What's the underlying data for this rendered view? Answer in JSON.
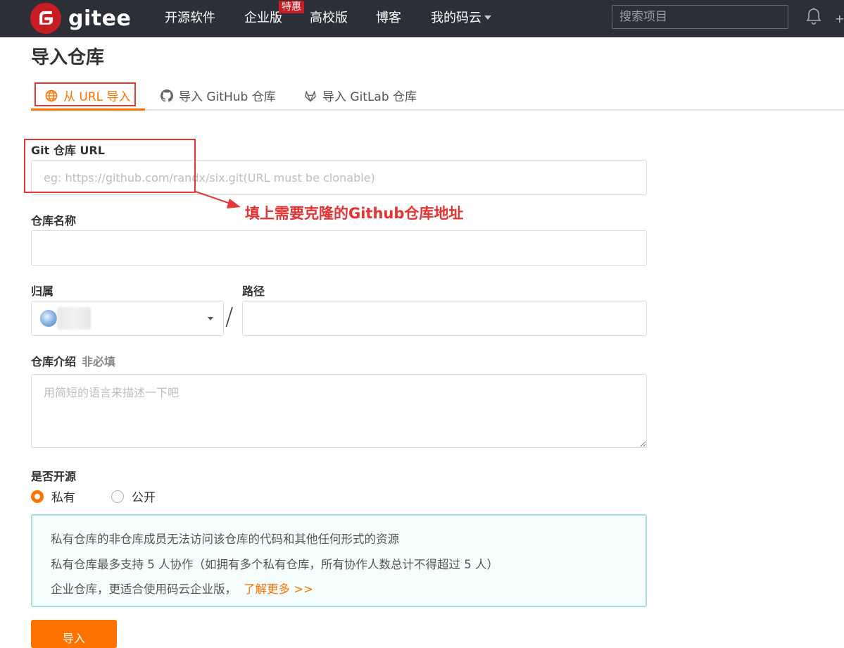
{
  "nav": {
    "logo_text": "gitee",
    "items": [
      "开源软件",
      "企业版",
      "高校版",
      "博客",
      "我的码云"
    ],
    "badge": "特惠",
    "search_placeholder": "搜索项目",
    "plus": "+"
  },
  "page": {
    "title": "导入仓库"
  },
  "tabs": [
    {
      "label": "从 URL 导入",
      "icon": "globe-icon",
      "active": true
    },
    {
      "label": "导入 GitHub 仓库",
      "icon": "github-icon",
      "active": false
    },
    {
      "label": "导入 GitLab 仓库",
      "icon": "gitlab-icon",
      "active": false
    }
  ],
  "form": {
    "git_url_label": "Git 仓库 URL",
    "git_url_placeholder": "eg: https://github.com/randx/six.git(URL must be clonable)",
    "git_url_value": "",
    "repo_name_label": "仓库名称",
    "repo_name_value": "",
    "owner_label": "归属",
    "path_label": "路径",
    "path_value": "",
    "separator": "/",
    "desc_label": "仓库介绍",
    "desc_optional": "非必填",
    "desc_placeholder": "用简短的语言来描述一下吧",
    "visibility_label": "是否开源",
    "visibility_options": [
      {
        "label": "私有",
        "checked": true
      },
      {
        "label": "公开",
        "checked": false
      }
    ],
    "submit_label": "导入"
  },
  "info_box": {
    "line1": "私有仓库的非仓库成员无法访问该仓库的代码和其他任何形式的资源",
    "line2": "私有仓库最多支持 5 人协作（如拥有多个私有仓库，所有协作人数总计不得超过 5 人）",
    "line3": "企业仓库，更适合使用码云企业版，",
    "link": "了解更多 >>"
  },
  "annotation": {
    "text": "填上需要克隆的Github仓库地址",
    "color": "#e53333"
  },
  "colors": {
    "accent": "#fe7300",
    "topbar": "#2c2f38",
    "brand_red": "#c71d23"
  }
}
